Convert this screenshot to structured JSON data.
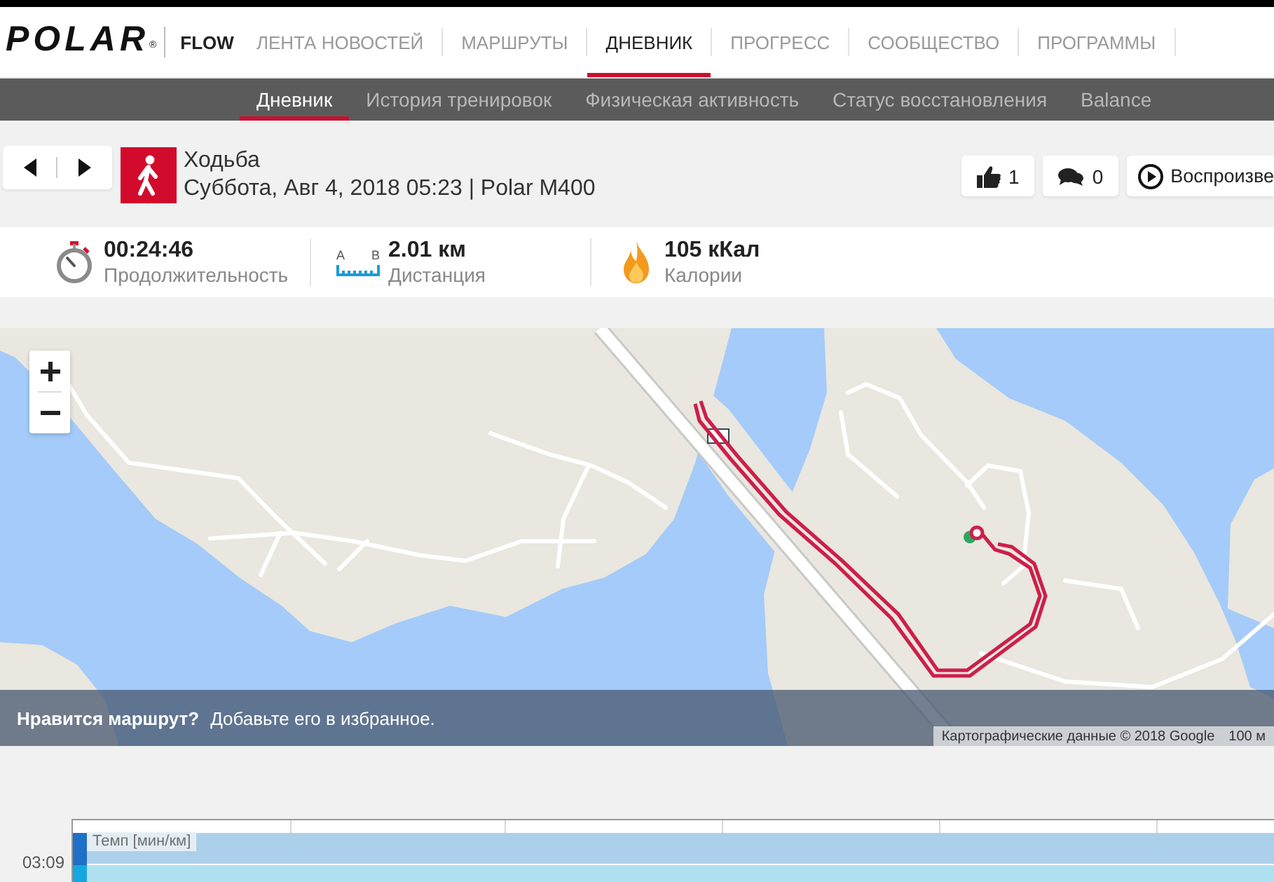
{
  "header": {
    "logo": "POLAR",
    "logo_mark": "®",
    "product": "FLOW",
    "nav": [
      {
        "label": "ЛЕНТА НОВОСТЕЙ",
        "selected": false
      },
      {
        "label": "МАРШРУТЫ",
        "selected": false
      },
      {
        "label": "ДНЕВНИК",
        "selected": true
      },
      {
        "label": "ПРОГРЕСС",
        "selected": false
      },
      {
        "label": "СООБЩЕСТВО",
        "selected": false
      },
      {
        "label": "ПРОГРАММЫ",
        "selected": false
      }
    ]
  },
  "subnav": [
    {
      "label": "Дневник",
      "selected": true
    },
    {
      "label": "История тренировок",
      "selected": false
    },
    {
      "label": "Физическая активность",
      "selected": false
    },
    {
      "label": "Статус восстановления",
      "selected": false
    },
    {
      "label": "Balance",
      "selected": false
    }
  ],
  "activity": {
    "title": "Ходьба",
    "subtitle": "Суббота, Авг 4, 2018 05:23 | Polar M400",
    "actions": [
      {
        "kind": "like",
        "label": "1"
      },
      {
        "kind": "comment",
        "label": "0"
      },
      {
        "kind": "play",
        "label": "Воспроизве"
      }
    ]
  },
  "stats": [
    {
      "kind": "duration",
      "value": "00:24:46",
      "label": "Продолжительность"
    },
    {
      "kind": "distance",
      "value": "2.01 км",
      "label": "Дистанция",
      "icon_letters": [
        "A",
        "B"
      ]
    },
    {
      "kind": "calories",
      "value": "105 кКал",
      "label": "Калории"
    }
  ],
  "map": {
    "prompt_title": "Нравится маршрут?",
    "prompt_text": "Добавьте его в избранное.",
    "attribution": "Картографические данные © 2018 Google",
    "scale": "100 м"
  },
  "chart": {
    "legend": "Темп [мин/км]",
    "y_tick": "03:09"
  }
}
